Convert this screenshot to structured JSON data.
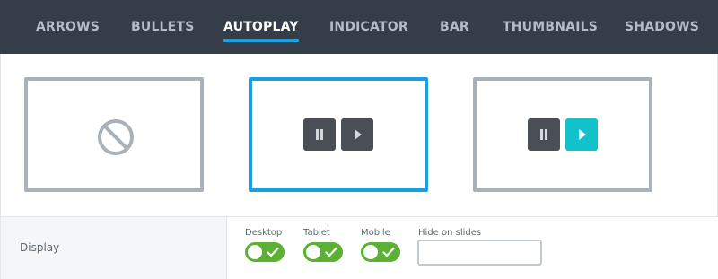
{
  "tabs": [
    {
      "label": "ARROWS",
      "active": false
    },
    {
      "label": "BULLETS",
      "active": false
    },
    {
      "label": "AUTOPLAY",
      "active": true
    },
    {
      "label": "INDICATOR",
      "active": false
    },
    {
      "label": "BAR",
      "active": false
    },
    {
      "label": "THUMBNAILS",
      "active": false
    },
    {
      "label": "SHADOWS",
      "active": false
    }
  ],
  "options": [
    {
      "icon": "no-symbol-icon",
      "selected": false
    },
    {
      "icon": "pause-play-buttons-icon",
      "selected": true
    },
    {
      "icon": "pause-play-teal-buttons-icon",
      "selected": false
    }
  ],
  "colors": {
    "tabbar_bg": "#353d48",
    "active_underline": "#1da0de",
    "card_border": "#a9b2b8",
    "selected_border": "#1d9ee0",
    "button_dark": "#4a4f55",
    "button_teal": "#13c1cb",
    "toggle_on": "#5cb034"
  },
  "display": {
    "label": "Display",
    "desktop": {
      "label": "Desktop",
      "on": true
    },
    "tablet": {
      "label": "Tablet",
      "on": true
    },
    "mobile": {
      "label": "Mobile",
      "on": true
    },
    "hide_on_slides": {
      "label": "Hide on slides",
      "value": ""
    }
  }
}
